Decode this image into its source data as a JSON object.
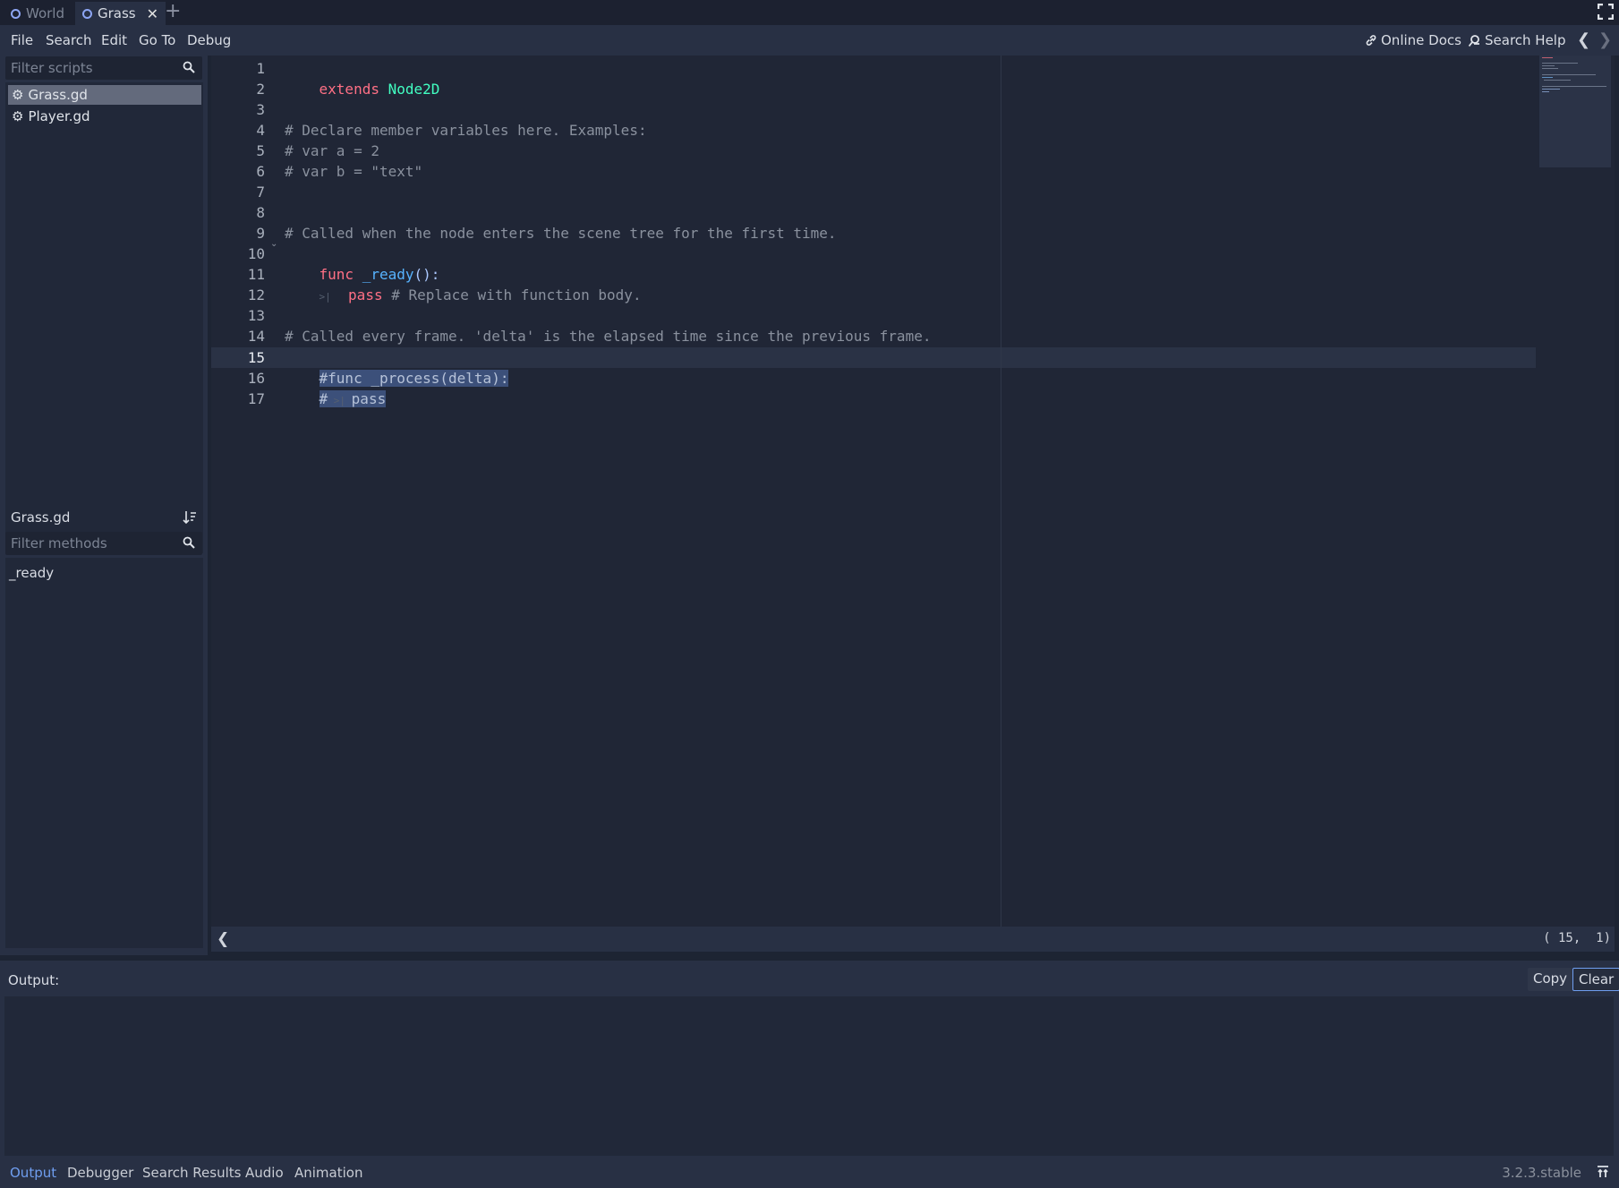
{
  "scene_tabs": [
    {
      "label": "World",
      "active": false
    },
    {
      "label": "Grass",
      "active": true
    }
  ],
  "tab_close": "✕",
  "tab_add": "+",
  "menu": {
    "file": "File",
    "search": "Search",
    "edit": "Edit",
    "goto": "Go To",
    "debug": "Debug",
    "online_docs": "Online Docs",
    "search_help": "Search Help",
    "nav_back": "❮",
    "nav_forward": "❯"
  },
  "scripts_panel": {
    "filter_placeholder": "Filter scripts",
    "items": [
      {
        "name": "Grass.gd",
        "selected": true
      },
      {
        "name": "Player.gd",
        "selected": false
      }
    ],
    "current_script": "Grass.gd",
    "methods_filter_placeholder": "Filter methods",
    "methods": [
      "_ready"
    ]
  },
  "editor": {
    "line_numbers": [
      "1",
      "2",
      "3",
      "4",
      "5",
      "6",
      "7",
      "8",
      "9",
      "10",
      "11",
      "12",
      "13",
      "14",
      "15",
      "16",
      "17"
    ],
    "current_line": "15",
    "lines": {
      "l1_kw": "extends",
      "l1_type": "Node2D",
      "l4": "# Declare member variables here. Examples:",
      "l5": "# var a = 2",
      "l6": "# var b = \"text\"",
      "l9": "# Called when the node enters the scene tree for the first time.",
      "l10_kw": "func",
      "l10_fn": "_ready",
      "l10_sym": "():",
      "l11_kw": "pass",
      "l11_cm": "# Replace with function body.",
      "l14": "# Called every frame. 'delta' is the elapsed time since the previous frame.",
      "l15": "#func _process(delta):",
      "l16_hash": "#",
      "l16_pass": "pass"
    },
    "status_arrow": "❮",
    "caret_position": "( 15,  1)"
  },
  "output": {
    "label": "Output:",
    "copy": "Copy",
    "clear": "Clear"
  },
  "bottom_tabs": [
    "Output",
    "Debugger",
    "Search Results",
    "Audio",
    "Animation"
  ],
  "active_bottom_tab": "Output",
  "version": "3.2.3.stable",
  "colors": {
    "accent": "#6f9ef0",
    "keyword": "#ff7085",
    "type": "#42ffc2",
    "function": "#57b3ff",
    "comment": "#8a919e"
  }
}
